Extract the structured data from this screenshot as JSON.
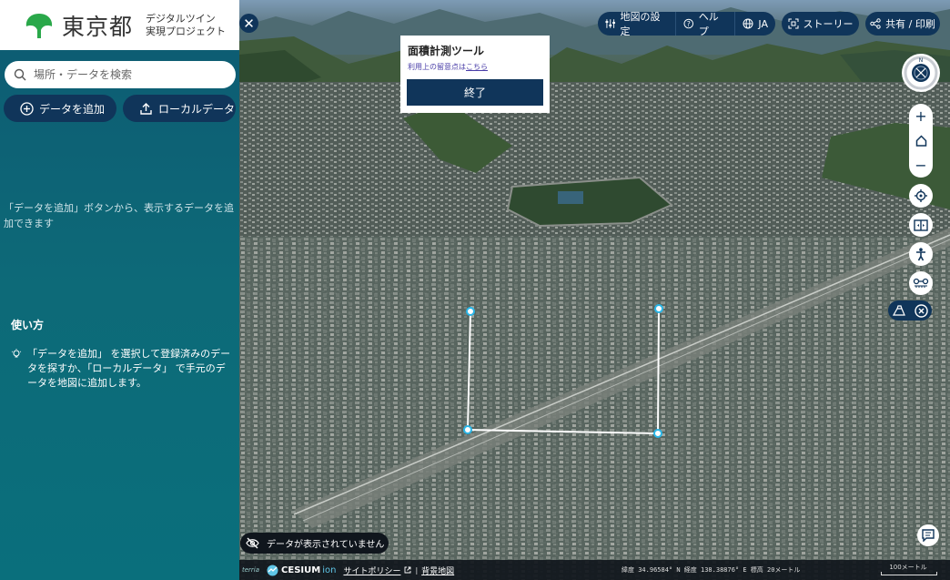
{
  "brand": {
    "name": "東京都",
    "subtitle_line1": "デジタルツイン",
    "subtitle_line2": "実現プロジェクト"
  },
  "search": {
    "placeholder": "場所・データを検索"
  },
  "sidebar": {
    "add_data_label": "データを追加",
    "local_data_label": "ローカルデータ",
    "hint": "「データを追加」ボタンから、表示するデータを追加できます",
    "howto_title": "使い方",
    "howto_body": "「データを追加」 を選択して登録済みのデータを探すか、「ローカルデータ」 で手元のデータを地図に追加します。"
  },
  "toolbar": {
    "map_settings": "地図の設定",
    "help": "ヘルプ",
    "language": "JA",
    "story": "ストーリー",
    "share": "共有 / 印刷"
  },
  "measure": {
    "title": "面積計測ツール",
    "note_prefix": "利用上の留意点は",
    "note_link": "こちら",
    "finish": "終了"
  },
  "map": {
    "no_data": "データが表示されていません",
    "compass_north": "N"
  },
  "footer": {
    "terria": "terria",
    "cesium": "CESIUM",
    "ion": "ion",
    "site_policy": "サイトポリシー",
    "separator": "|",
    "basemap": "背景地図",
    "coords": "緯度  34.96584° N    経度  138.38876° E    標高  20メートル",
    "scale_label": "100メートル"
  },
  "colors": {
    "navy": "#10355a",
    "sidebar_top": "#0d5a72",
    "sidebar_bottom": "#0a6f7c",
    "logo_green": "#2aa84a",
    "measure_point": "#29b6e8"
  }
}
